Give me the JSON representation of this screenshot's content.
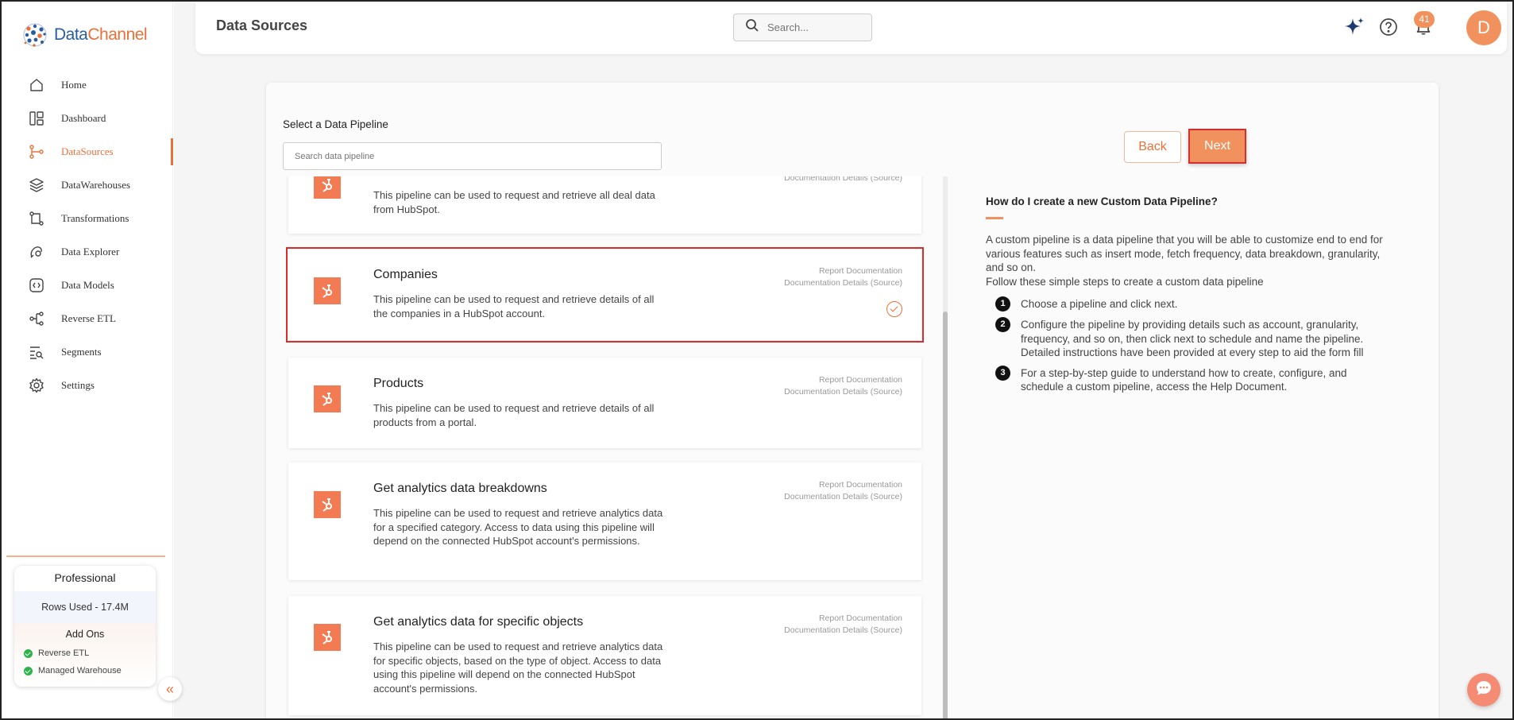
{
  "brand": {
    "name_part1": "Data",
    "name_part2": "Channel"
  },
  "sidebar": {
    "items": [
      {
        "label": "Home",
        "icon": "home-icon"
      },
      {
        "label": "Dashboard",
        "icon": "dashboard-icon"
      },
      {
        "label": "DataSources",
        "icon": "datasources-icon",
        "active": true
      },
      {
        "label": "DataWarehouses",
        "icon": "datawarehouses-icon"
      },
      {
        "label": "Transformations",
        "icon": "transformations-icon"
      },
      {
        "label": "Data Explorer",
        "icon": "data-explorer-icon"
      },
      {
        "label": "Data Models",
        "icon": "data-models-icon"
      },
      {
        "label": "Reverse ETL",
        "icon": "reverse-etl-icon"
      },
      {
        "label": "Segments",
        "icon": "segments-icon"
      },
      {
        "label": "Settings",
        "icon": "settings-icon"
      }
    ],
    "plan": {
      "title": "Professional",
      "rows_used": "Rows Used - 17.4M",
      "addons_title": "Add Ons",
      "addons": [
        "Reverse ETL",
        "Managed Warehouse"
      ]
    },
    "collapse_glyph": "«"
  },
  "header": {
    "title": "Data Sources",
    "search_placeholder": "Search...",
    "notification_count": "41",
    "avatar_initial": "D"
  },
  "content": {
    "select_label": "Select a Data Pipeline",
    "search_placeholder": "Search data pipeline",
    "back_label": "Back",
    "next_label": "Next",
    "pipelines": [
      {
        "title": "",
        "desc": "This pipeline can be used to request and retrieve all deal data from HubSpot.",
        "link1": "",
        "link2": "Documentation Details (Source)",
        "selected": false
      },
      {
        "title": "Companies",
        "desc": "This pipeline can be used to request and retrieve details of all the companies in a HubSpot account.",
        "link1": "Report Documentation",
        "link2": "Documentation Details (Source)",
        "selected": true
      },
      {
        "title": "Products",
        "desc": "This pipeline can be used to request and retrieve details of all products from a portal.",
        "link1": "Report Documentation",
        "link2": "Documentation Details (Source)",
        "selected": false
      },
      {
        "title": "Get analytics data breakdowns",
        "desc": "This pipeline can be used to request and retrieve analytics data for a specified category. Access to data using this pipeline will depend on the connected HubSpot account's permissions.",
        "link1": "Report Documentation",
        "link2": "Documentation Details (Source)",
        "selected": false
      },
      {
        "title": "Get analytics data for specific objects",
        "desc": "This pipeline can be used to request and retrieve analytics data for specific objects, based on the type of object. Access to data using this pipeline will depend on the connected HubSpot account's permissions.",
        "link1": "Report Documentation",
        "link2": "Documentation Details (Source)",
        "selected": false
      }
    ],
    "help": {
      "question": "How do I create a new Custom Data Pipeline?",
      "paragraph": "A custom pipeline is a data pipeline that you will be able to customize end to end for various features such as insert mode, fetch frequency, data breakdown, granularity, and so on.",
      "paragraph2": "Follow these simple steps to create a custom data pipeline",
      "steps": [
        {
          "n": "1",
          "text": "Choose a pipeline and click next."
        },
        {
          "n": "2",
          "text": "Configure the pipeline by providing details such as account, granularity, frequency, and so on, then click next to schedule and name the pipeline. Detailed instructions have been provided at every step to aid the form fill"
        },
        {
          "n": "3",
          "text": "For a step-by-step guide to understand how to create, configure, and schedule a custom pipeline, access the Help Document."
        }
      ]
    }
  },
  "colors": {
    "accent": "#e8713a",
    "hubspot": "#f27b54",
    "badge": "#f1915e",
    "selection_outline": "#d32f2f"
  }
}
